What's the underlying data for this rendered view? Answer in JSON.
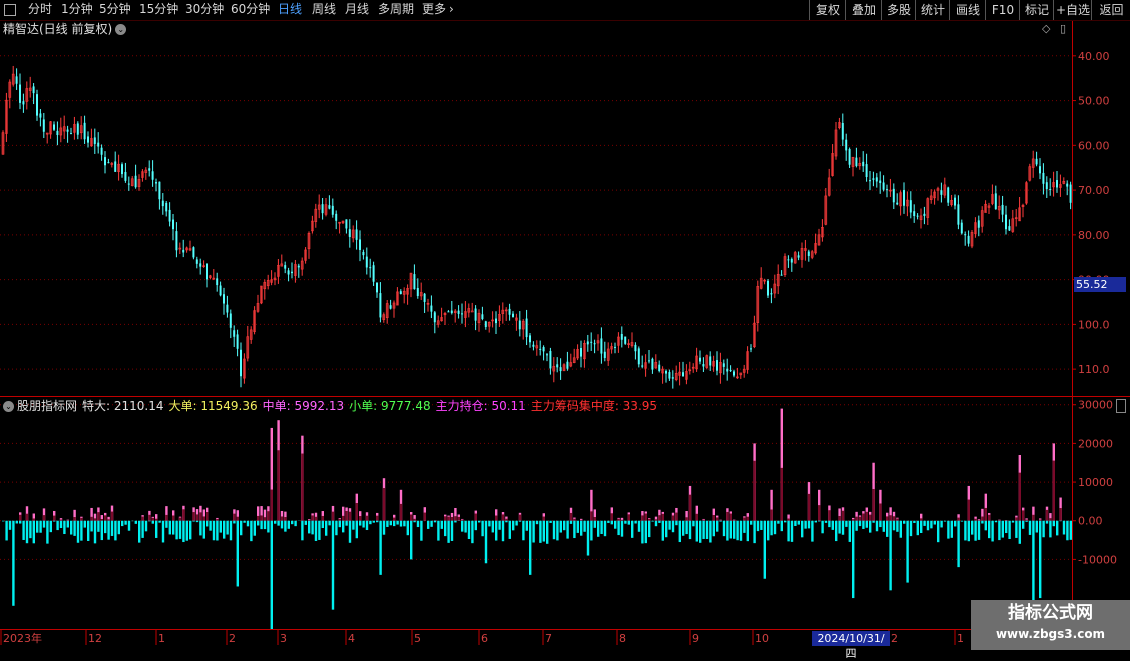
{
  "toolbar": {
    "window_icon": "window-icon",
    "periods": [
      "分时",
      "1分钟",
      "5分钟",
      "15分钟",
      "30分钟",
      "60分钟",
      "日线",
      "周线",
      "月线",
      "多周期",
      "更多"
    ],
    "active_period": "日线",
    "more_arrow": "›",
    "right_buttons": [
      "复权",
      "叠加",
      "多股",
      "统计",
      "画线",
      "F10",
      "标记",
      "+自选",
      "返回"
    ]
  },
  "main_pane": {
    "title": "精智达(日线 前复权)",
    "title_icon": "chevron-down-icon",
    "y_ticks": [
      "110.0",
      "100.0",
      "90.00",
      "80.00",
      "70.00",
      "60.00",
      "50.00",
      "40.00"
    ],
    "current_price": "55.52"
  },
  "indicator_pane": {
    "name": "股朋指标网",
    "stats": [
      {
        "label": "特大: ",
        "value": "2110.14",
        "color": "#e0e0e0"
      },
      {
        "label": "大单: ",
        "value": "11549.36",
        "color": "#f0f060"
      },
      {
        "label": "中单: ",
        "value": "5992.13",
        "color": "#ff66ff"
      },
      {
        "label": "小单: ",
        "value": "9777.48",
        "color": "#50ff50"
      },
      {
        "label": "主力持仓: ",
        "value": "50.11",
        "color": "#ff44ff"
      },
      {
        "label": "主力筹码集中度: ",
        "value": "33.95",
        "color": "#ff3030"
      }
    ],
    "y_ticks": [
      "30000",
      "20000",
      "10000",
      "0.00",
      "-10000"
    ]
  },
  "x_axis": {
    "labels": [
      "2023年",
      "12",
      "1",
      "2",
      "3",
      "4",
      "5",
      "6",
      "7",
      "8",
      "9",
      "10",
      "2024/10/31/四",
      "2",
      "1"
    ],
    "selected_date": "2024/10/31/四"
  },
  "colors": {
    "up_candle": "#ff3c3c",
    "down_candle": "#54ffff",
    "positive_bar": "#ff6ec7",
    "negative_bar": "#00f0f0",
    "grid": "#7a0000",
    "axis": "#c00000"
  },
  "watermark": {
    "line1": "指标公式网",
    "line2": "www.zbgs3.com"
  },
  "chart_data": [
    {
      "type": "candlestick",
      "title": "精智达(日线 前复权)",
      "ylim": [
        34,
        118
      ],
      "y_ticks": [
        40,
        50,
        60,
        70,
        80,
        90,
        100,
        110
      ],
      "close_path_anchors": [
        [
          0,
          88
        ],
        [
          10,
          108
        ],
        [
          20,
          100
        ],
        [
          30,
          103
        ],
        [
          40,
          95
        ],
        [
          55,
          93
        ],
        [
          75,
          93
        ],
        [
          90,
          92
        ],
        [
          110,
          85
        ],
        [
          135,
          82
        ],
        [
          150,
          84
        ],
        [
          175,
          68
        ],
        [
          200,
          63
        ],
        [
          225,
          55
        ],
        [
          240,
          40
        ],
        [
          255,
          55
        ],
        [
          275,
          62
        ],
        [
          300,
          62
        ],
        [
          315,
          75
        ],
        [
          330,
          75
        ],
        [
          345,
          72
        ],
        [
          365,
          65
        ],
        [
          380,
          52
        ],
        [
          400,
          58
        ],
        [
          410,
          60
        ],
        [
          430,
          52
        ],
        [
          450,
          53
        ],
        [
          470,
          52
        ],
        [
          490,
          50
        ],
        [
          500,
          53
        ],
        [
          520,
          50
        ],
        [
          545,
          42
        ],
        [
          565,
          40
        ],
        [
          590,
          46
        ],
        [
          605,
          44
        ],
        [
          620,
          48
        ],
        [
          640,
          42
        ],
        [
          660,
          40
        ],
        [
          680,
          39
        ],
        [
          700,
          42
        ],
        [
          720,
          40
        ],
        [
          740,
          38
        ],
        [
          750,
          46
        ],
        [
          758,
          60
        ],
        [
          770,
          57
        ],
        [
          785,
          65
        ],
        [
          800,
          65
        ],
        [
          820,
          70
        ],
        [
          830,
          87
        ],
        [
          838,
          95
        ],
        [
          845,
          88
        ],
        [
          860,
          85
        ],
        [
          880,
          80
        ],
        [
          900,
          78
        ],
        [
          920,
          73
        ],
        [
          935,
          82
        ],
        [
          950,
          78
        ],
        [
          965,
          68
        ],
        [
          990,
          78
        ],
        [
          1005,
          72
        ],
        [
          1020,
          75
        ],
        [
          1030,
          88
        ],
        [
          1045,
          80
        ],
        [
          1060,
          83
        ],
        [
          1075,
          76
        ]
      ],
      "current_price": 55.52
    },
    {
      "type": "bar",
      "title": "股朋指标网",
      "ylim": [
        -28000,
        32000
      ],
      "y_ticks": [
        30000,
        20000,
        10000,
        0,
        -10000
      ],
      "series": [
        {
          "name": "特大",
          "last_value": 2110.14
        },
        {
          "name": "大单",
          "last_value": 11549.36
        },
        {
          "name": "中单",
          "last_value": 5992.13
        },
        {
          "name": "小单",
          "last_value": 9777.48
        },
        {
          "name": "主力持仓",
          "last_value": 50.11
        },
        {
          "name": "主力筹码集中度",
          "last_value": 33.95
        }
      ]
    }
  ]
}
